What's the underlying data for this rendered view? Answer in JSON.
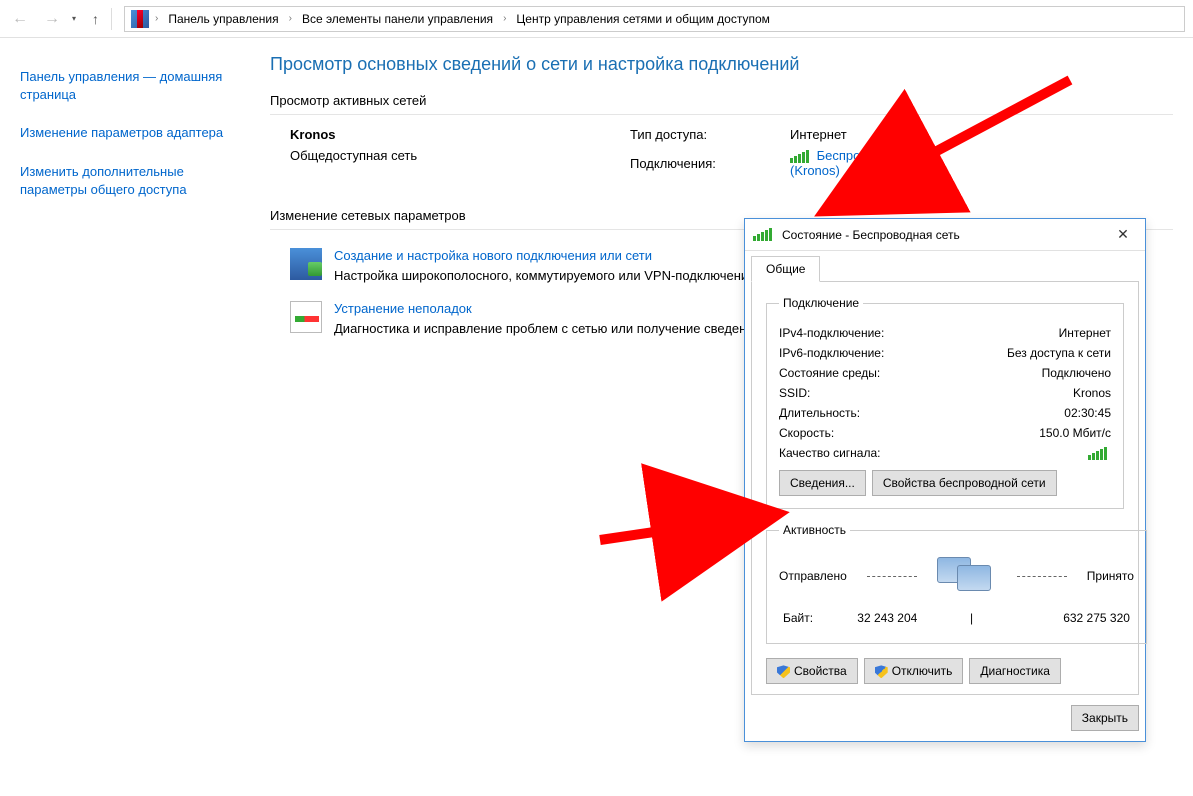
{
  "toolbar": {
    "breadcrumb": {
      "root": "Панель управления",
      "all": "Все элементы панели управления",
      "current": "Центр управления сетями и общим доступом"
    }
  },
  "sidebar": {
    "home": "Панель управления — домашняя страница",
    "adapter": "Изменение параметров адаптера",
    "sharing": "Изменить дополнительные параметры общего доступа"
  },
  "page": {
    "title": "Просмотр основных сведений о сети и настройка подключений",
    "active_label": "Просмотр активных сетей",
    "change_label": "Изменение сетевых параметров"
  },
  "network": {
    "name": "Kronos",
    "type": "Общедоступная сеть",
    "access_label": "Тип доступа:",
    "access_value": "Интернет",
    "conn_label": "Подключения:",
    "conn_link_line1": "Беспроводная сеть",
    "conn_link_line2": "(Kronos)"
  },
  "options": {
    "setup_link": "Создание и настройка нового подключения или сети",
    "setup_desc": "Настройка широкополосного, коммутируемого или VPN-подключения либо настройка маршрутизатора или точки доступа.",
    "diag_link": "Устранение неполадок",
    "diag_desc": "Диагностика и исправление проблем с сетью или получение сведений об устранении неполадок."
  },
  "dialog": {
    "title": "Состояние - Беспроводная сеть",
    "tab_general": "Общие",
    "group_connection": "Подключение",
    "ipv4_l": "IPv4-подключение:",
    "ipv4_v": "Интернет",
    "ipv6_l": "IPv6-подключение:",
    "ipv6_v": "Без доступа к сети",
    "state_l": "Состояние среды:",
    "state_v": "Подключено",
    "ssid_l": "SSID:",
    "ssid_v": "Kronos",
    "dur_l": "Длительность:",
    "dur_v": "02:30:45",
    "speed_l": "Скорость:",
    "speed_v": "150.0 Мбит/с",
    "signal_l": "Качество сигнала:",
    "btn_details": "Сведения...",
    "btn_wprops": "Свойства беспроводной сети",
    "group_activity": "Активность",
    "sent_l": "Отправлено",
    "recv_l": "Принято",
    "bytes_l": "Байт:",
    "bytes_sent": "32 243 204",
    "bytes_recv": "632 275 320",
    "btn_props": "Свойства",
    "btn_disable": "Отключить",
    "btn_diag": "Диагностика",
    "btn_close": "Закрыть"
  }
}
